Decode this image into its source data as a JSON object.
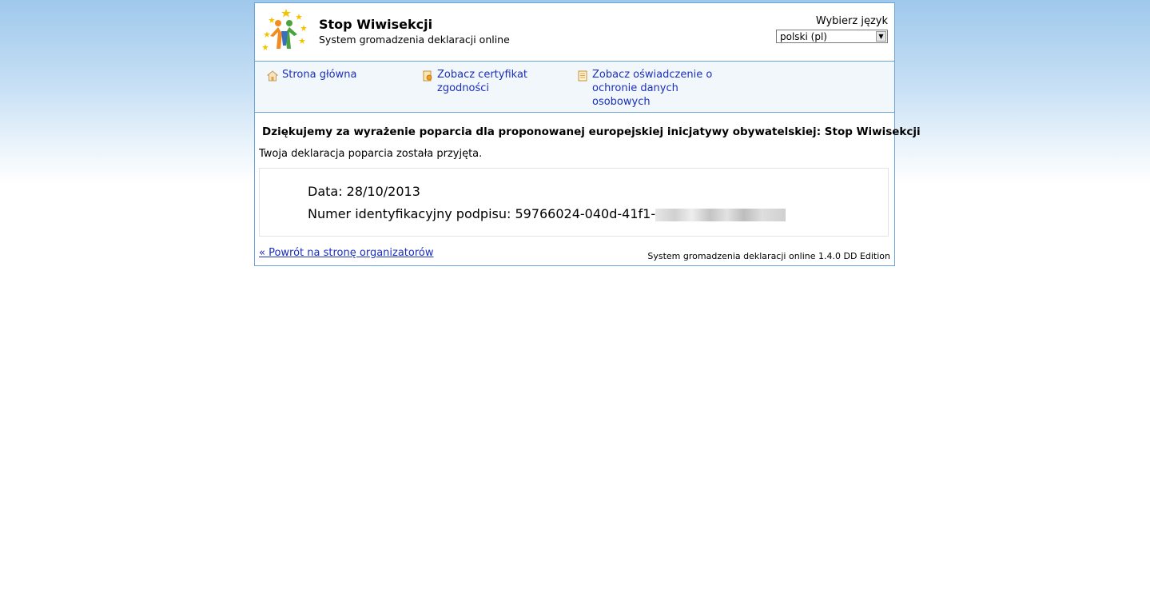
{
  "header": {
    "title": "Stop Wiwisekcji",
    "subtitle": "System gromadzenia deklaracji online",
    "language_label": "Wybierz język",
    "language_selected": "polski (pl)"
  },
  "nav": {
    "items": [
      {
        "label": "Strona główna",
        "icon": "home-icon"
      },
      {
        "label": "Zobacz certyfikat zgodności",
        "icon": "certificate-icon"
      },
      {
        "label": "Zobacz oświadczenie o ochronie danych osobowych",
        "icon": "document-icon"
      }
    ]
  },
  "main": {
    "thanks": "Dziękujemy za wyrażenie poparcia dla proponowanej europejskiej inicjatywy obywatelskiej: Stop Wiwisekcji",
    "accepted": "Twoja deklaracja poparcia została przyjęta.",
    "date_line": "Data: 28/10/2013",
    "id_line": "Numer identyfikacyjny podpisu: 59766024-040d-41f1-"
  },
  "footer": {
    "back_link": "« Powrót na stronę organizatorów",
    "version": "System gromadzenia deklaracji online 1.4.0 DD Edition"
  },
  "colors": {
    "link": "#1a2fbf",
    "border": "#6aa3d5",
    "nav_background": "#f2f7fb"
  }
}
